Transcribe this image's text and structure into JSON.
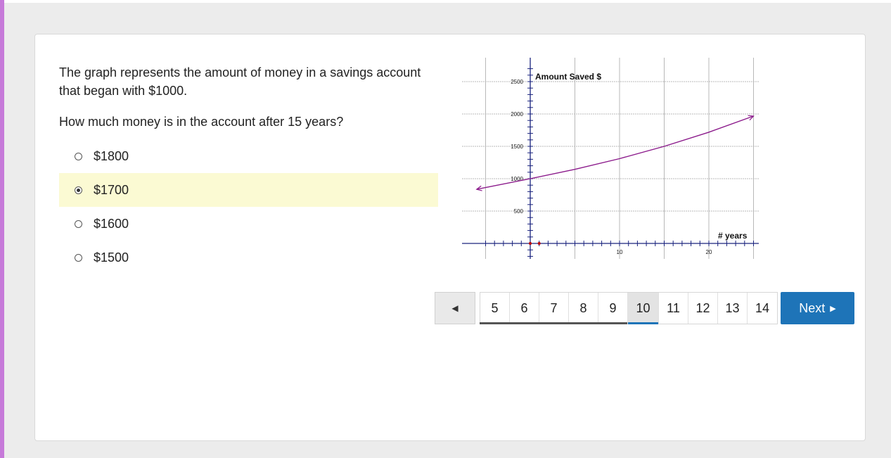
{
  "question": {
    "line1": "The graph represents the amount of money in a savings account that began with $1000.",
    "prompt": "How much money is in the account after 15 years?"
  },
  "choices": [
    {
      "label": "$1800",
      "selected": false
    },
    {
      "label": "$1700",
      "selected": true
    },
    {
      "label": "$1600",
      "selected": false
    },
    {
      "label": "$1500",
      "selected": false
    }
  ],
  "graph": {
    "y_title": "Amount Saved $",
    "x_title": "# years",
    "y_ticks": [
      "500",
      "1000",
      "1500",
      "2000",
      "2500"
    ],
    "x_ticks": [
      "10",
      "20"
    ],
    "line_color": "#8b1a8b",
    "axis_color": "#1a237e"
  },
  "chart_data": {
    "type": "line",
    "ylabel": "Amount Saved $",
    "xlabel": "# years",
    "xlim": [
      -5,
      25
    ],
    "ylim": [
      0,
      2500
    ],
    "series": [
      {
        "x": [
          -6,
          0,
          5,
          10,
          15,
          20,
          25
        ],
        "y": [
          836,
          1000,
          1145,
          1310,
          1500,
          1718,
          1967
        ]
      }
    ]
  },
  "pagination": {
    "prev_icon": "◀",
    "pages": [
      "5",
      "6",
      "7",
      "8",
      "9",
      "10",
      "11",
      "12",
      "13",
      "14"
    ],
    "current": "10",
    "next_label": "Next",
    "next_icon": "▶"
  }
}
